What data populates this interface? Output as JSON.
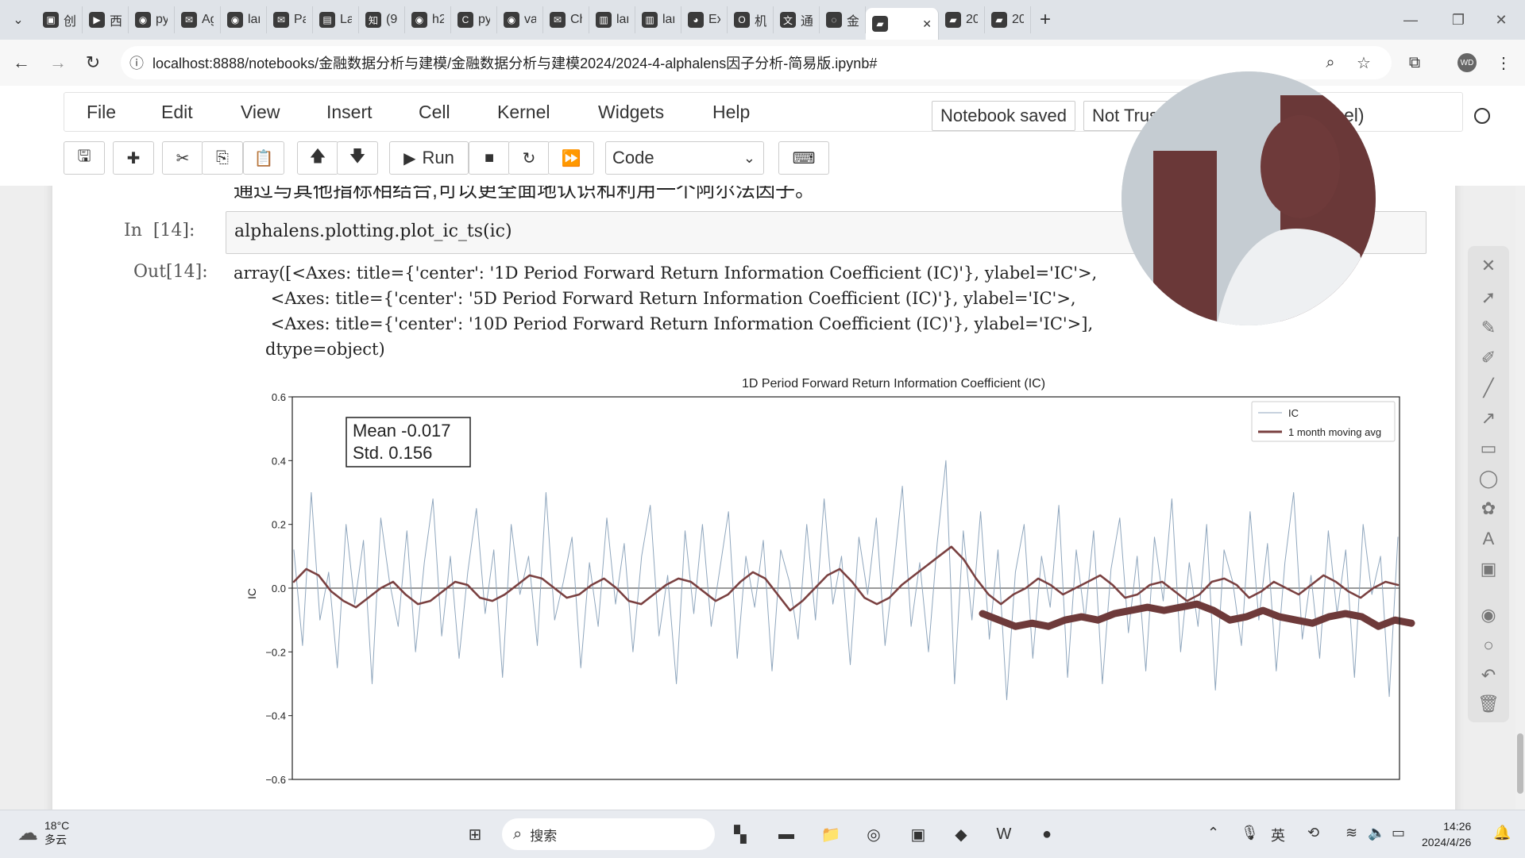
{
  "browser": {
    "tabs": [
      {
        "icon": "bilibili-icon",
        "label": "创"
      },
      {
        "icon": "media-icon",
        "label": "西"
      },
      {
        "icon": "github-icon",
        "label": "py"
      },
      {
        "icon": "mail-icon",
        "label": "Ag"
      },
      {
        "icon": "github-icon",
        "label": "lar"
      },
      {
        "icon": "mail-icon",
        "label": "Pa"
      },
      {
        "icon": "doc-icon",
        "label": "La"
      },
      {
        "icon": "zhihu-icon",
        "label": "(9"
      },
      {
        "icon": "github-icon",
        "label": "h2"
      },
      {
        "icon": "c-icon",
        "label": "py"
      },
      {
        "icon": "github-icon",
        "label": "va"
      },
      {
        "icon": "mail-icon",
        "label": "Ch"
      },
      {
        "icon": "book-icon",
        "label": "lar"
      },
      {
        "icon": "book-icon",
        "label": "lar"
      },
      {
        "icon": "user-icon",
        "label": "Ex"
      },
      {
        "icon": "o-icon",
        "label": "机"
      },
      {
        "icon": "translate-icon",
        "label": "通"
      },
      {
        "icon": "loading-icon",
        "label": "金"
      },
      {
        "icon": "jupyter-icon",
        "label": ""
      },
      {
        "icon": "jupyter-icon",
        "label": "20"
      },
      {
        "icon": "jupyter-icon",
        "label": "20"
      }
    ],
    "url": "localhost:8888/notebooks/金融数据分析与建模/金融数据分析与建模2024/2024-4-alphalens因子分析-简易版.ipynb#",
    "profile": "WD"
  },
  "jupyter": {
    "menu": [
      "File",
      "Edit",
      "View",
      "Insert",
      "Cell",
      "Kernel",
      "Widgets",
      "Help"
    ],
    "notebook_status": "Notebook saved",
    "trust_status": "Not Trusted",
    "kernel": "Python 3 (ipykernel)",
    "run_label": "Run",
    "cell_type": "Code"
  },
  "notebook": {
    "markdown_line": "通过与其他指标相结合,可以更全面地认识和利用一个阿尔法因子。",
    "in_prompt": "In  [14]:",
    "code": "alphalens.plotting.plot_ic_ts(ic)",
    "out_prompt": "Out[14]:",
    "output_lines": [
      "array([<Axes: title={'center': '1D Period Forward Return Information Coefficient (IC)'}, ylabel='IC'>,",
      "       <Axes: title={'center': '5D Period Forward Return Information Coefficient (IC)'}, ylabel='IC'>,",
      "       <Axes: title={'center': '10D Period Forward Return Information Coefficient (IC)'}, ylabel='IC'>],",
      "      dtype=object)"
    ]
  },
  "chart_data": {
    "type": "line",
    "title": "1D Period Forward Return Information Coefficient (IC)",
    "ylabel": "IC",
    "ylim": [
      -0.6,
      0.6
    ],
    "yticks": [
      "0.6",
      "0.4",
      "0.2",
      "0.0",
      "−0.2",
      "−0.4",
      "−0.6"
    ],
    "ytick_values": [
      0.6,
      0.4,
      0.2,
      0.0,
      -0.2,
      -0.4,
      -0.6
    ],
    "stats_box": {
      "mean": "Mean -0.017",
      "std": "Std. 0.156"
    },
    "legend_position": "top-right",
    "series": [
      {
        "name": "IC",
        "color": "#8fa6bd",
        "style": "thin",
        "values": [
          0.12,
          -0.18,
          0.3,
          -0.1,
          0.05,
          -0.25,
          0.2,
          -0.05,
          0.15,
          -0.3,
          0.22,
          0.02,
          -0.12,
          0.18,
          -0.2,
          0.08,
          0.28,
          -0.15,
          0.1,
          -0.22,
          0.05,
          0.25,
          -0.08,
          0.12,
          -0.28,
          0.2,
          -0.02,
          0.1,
          -0.18,
          0.3,
          -0.1,
          0.02,
          0.16,
          -0.25,
          0.08,
          -0.12,
          0.22,
          -0.05,
          0.14,
          -0.2,
          0.1,
          0.26,
          -0.15,
          0.04,
          -0.3,
          0.18,
          -0.08,
          0.2,
          -0.12,
          0.06,
          0.24,
          -0.22,
          0.1,
          -0.06,
          0.15,
          -0.26,
          0.12,
          0.02,
          -0.16,
          0.2,
          -0.1,
          0.28,
          -0.05,
          0.1,
          -0.24,
          0.16,
          -0.02,
          0.22,
          -0.18,
          0.06,
          0.32,
          -0.12,
          0.08,
          -0.2,
          0.14,
          0.4,
          -0.3,
          0.18,
          -0.1,
          0.24,
          -0.16,
          0.12,
          -0.35,
          0.05,
          0.2,
          -0.22,
          0.1,
          -0.06,
          0.26,
          -0.28,
          0.12,
          -0.1,
          0.18,
          -0.3,
          0.06,
          0.22,
          -0.14,
          0.1,
          -0.26,
          0.16,
          -0.04,
          0.28,
          -0.2,
          0.08,
          -0.12,
          0.2,
          -0.32,
          0.12,
          0.02,
          -0.18,
          0.24,
          -0.1,
          0.14,
          -0.26,
          0.08,
          0.3,
          -0.16,
          0.04,
          -0.22,
          0.18,
          -0.08,
          0.12,
          -0.28,
          0.2,
          -0.02,
          0.1,
          -0.34,
          0.16
        ]
      },
      {
        "name": "1 month moving avg",
        "color": "#7a4040",
        "style": "medium",
        "values": [
          0.02,
          0.06,
          0.04,
          -0.01,
          -0.04,
          -0.06,
          -0.03,
          0.0,
          0.02,
          -0.02,
          -0.05,
          -0.04,
          -0.01,
          0.02,
          0.01,
          -0.03,
          -0.04,
          -0.02,
          0.01,
          0.04,
          0.03,
          0.0,
          -0.03,
          -0.02,
          0.01,
          0.03,
          0.0,
          -0.04,
          -0.05,
          -0.02,
          0.01,
          0.03,
          0.02,
          -0.01,
          -0.04,
          -0.02,
          0.02,
          0.05,
          0.03,
          -0.02,
          -0.07,
          -0.04,
          0.0,
          0.04,
          0.06,
          0.02,
          -0.03,
          -0.05,
          -0.03,
          0.01,
          0.04,
          0.07,
          0.1,
          0.13,
          0.09,
          0.03,
          -0.02,
          -0.05,
          -0.02,
          0.0,
          0.03,
          0.01,
          -0.02,
          0.0,
          0.02,
          0.04,
          0.01,
          -0.03,
          -0.02,
          0.01,
          0.02,
          -0.01,
          -0.04,
          -0.02,
          0.02,
          0.03,
          0.01,
          -0.03,
          -0.01,
          0.02,
          0.0,
          -0.02,
          0.01,
          0.04,
          0.02,
          -0.01,
          -0.03,
          0.0,
          0.02,
          0.01
        ]
      }
    ],
    "overlay_annotation": {
      "label": "hand-drawn trend stroke",
      "color": "#6e3a3a",
      "values": [
        -0.08,
        -0.1,
        -0.12,
        -0.11,
        -0.12,
        -0.1,
        -0.09,
        -0.1,
        -0.08,
        -0.07,
        -0.06,
        -0.07,
        -0.06,
        -0.05,
        -0.07,
        -0.1,
        -0.09,
        -0.07,
        -0.09,
        -0.1,
        -0.11,
        -0.09,
        -0.08,
        -0.09,
        -0.12,
        -0.1,
        -0.11
      ]
    }
  },
  "taskbar": {
    "temperature": "18°C",
    "weather_text": "多云",
    "search_placeholder": "搜索",
    "time": "14:26",
    "date": "2024/4/26"
  }
}
